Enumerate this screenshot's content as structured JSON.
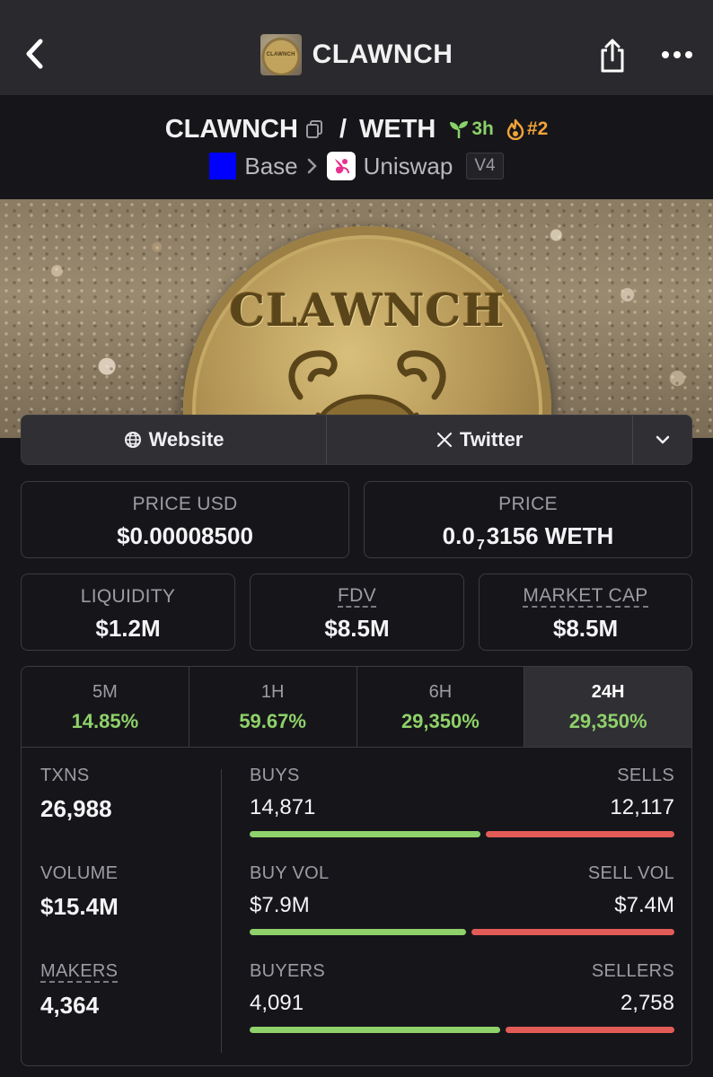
{
  "nav": {
    "title": "CLAWNCH",
    "thumb_text": "CLAWNCH"
  },
  "pair": {
    "base": "CLAWNCH",
    "separator": "/",
    "quote": "WETH",
    "age": "3h",
    "rank": "#2",
    "chain": "Base",
    "dex": "Uniswap",
    "version": "V4",
    "colors": {
      "age": "#8bd16a",
      "rank": "#f0a33a",
      "chain_logo": "#0000ff"
    }
  },
  "banner": {
    "coin_text": "CLAWNCH"
  },
  "links": {
    "website": "Website",
    "twitter": "Twitter"
  },
  "stats": {
    "price_usd": {
      "label": "PRICE USD",
      "value": "$0.00008500"
    },
    "price": {
      "label": "PRICE",
      "prefix": "0.0",
      "zeros": "7",
      "digits": "3156",
      "unit": "WETH"
    },
    "liquidity": {
      "label": "LIQUIDITY",
      "value": "$1.2M"
    },
    "fdv": {
      "label": "FDV",
      "value": "$8.5M"
    },
    "market_cap": {
      "label": "MARKET CAP",
      "value": "$8.5M"
    }
  },
  "changes": [
    {
      "label": "5M",
      "value": "14.85%"
    },
    {
      "label": "1H",
      "value": "59.67%"
    },
    {
      "label": "6H",
      "value": "29,350%"
    },
    {
      "label": "24H",
      "value": "29,350%",
      "active": true
    }
  ],
  "metrics": {
    "txns": {
      "label": "TXNS",
      "value": "26,988"
    },
    "volume": {
      "label": "VOLUME",
      "value": "$15.4M"
    },
    "makers": {
      "label": "MAKERS",
      "value": "4,364"
    },
    "buys": {
      "label": "BUYS",
      "value": "14,871",
      "share": 0.551
    },
    "sells": {
      "label": "SELLS",
      "value": "12,117",
      "share": 0.449
    },
    "buy_vol": {
      "label": "BUY VOL",
      "value": "$7.9M",
      "share": 0.516
    },
    "sell_vol": {
      "label": "SELL VOL",
      "value": "$7.4M",
      "share": 0.484
    },
    "buyers": {
      "label": "BUYERS",
      "value": "4,091",
      "share": 0.597
    },
    "sellers": {
      "label": "SELLERS",
      "value": "2,758",
      "share": 0.403
    },
    "colors": {
      "positive": "#8fd16a",
      "negative": "#e35b57"
    }
  }
}
